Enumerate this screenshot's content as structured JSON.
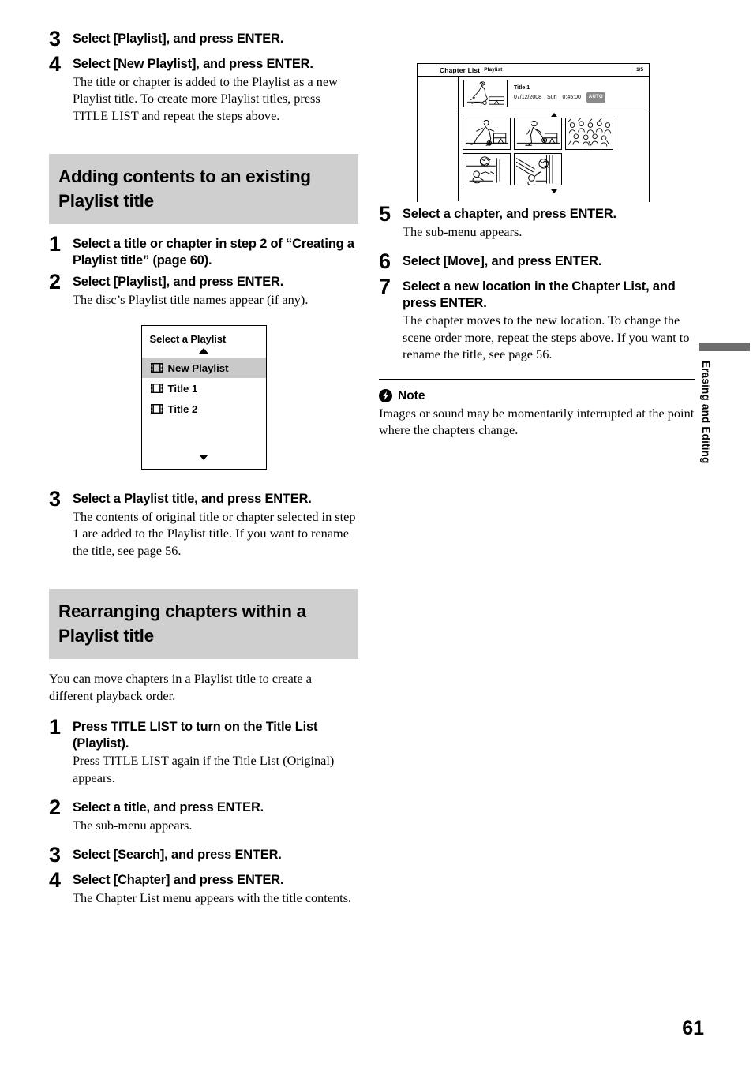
{
  "page": {
    "number": "61",
    "side_tab": "Erasing and Editing"
  },
  "left_column": {
    "steps_top": [
      {
        "num": "3",
        "title": "Select [Playlist], and press ENTER.",
        "desc": ""
      },
      {
        "num": "4",
        "title": "Select [New Playlist], and press ENTER.",
        "desc": "The title or chapter is added to the Playlist as a new Playlist title.\nTo create more Playlist titles, press TITLE LIST and repeat the steps above."
      }
    ],
    "section1": {
      "heading": "Adding contents to an existing Playlist title",
      "steps": [
        {
          "num": "1",
          "title": "Select a title or chapter in step 2 of “Creating a Playlist title” (page 60).",
          "desc": ""
        },
        {
          "num": "2",
          "title": "Select [Playlist], and press ENTER.",
          "desc": "The disc’s Playlist title names appear (if any)."
        }
      ],
      "dialog": {
        "title": "Select a Playlist",
        "items": [
          {
            "label": "New Playlist",
            "selected": true
          },
          {
            "label": "Title 1",
            "selected": false
          },
          {
            "label": "Title 2",
            "selected": false
          }
        ],
        "scroll_up_icon": "triangle-up-icon",
        "scroll_down_icon": "triangle-down-icon",
        "item_icon": "film-strip-icon"
      },
      "step_after_dialog": {
        "num": "3",
        "title": "Select a Playlist title, and press ENTER.",
        "desc": "The contents of original title or chapter selected in step 1 are added to the Playlist title.\nIf you want to rename the title, see page 56."
      }
    },
    "section2": {
      "heading": "Rearranging chapters within a Playlist title",
      "intro": "You can move chapters in a Playlist title to create a different playback order.",
      "steps": [
        {
          "num": "1",
          "title": "Press TITLE LIST to turn on the Title List (Playlist).",
          "desc": "Press TITLE LIST again if the Title List (Original) appears."
        },
        {
          "num": "2",
          "title": "Select a title, and press ENTER.",
          "desc": "The sub-menu appears."
        },
        {
          "num": "3",
          "title": "Select [Search], and press ENTER.",
          "desc": ""
        },
        {
          "num": "4",
          "title": "Select [Chapter] and press ENTER.",
          "desc": "The Chapter List menu appears with the title contents."
        }
      ]
    }
  },
  "right_column": {
    "screen": {
      "header_title": "Chapter List",
      "header_subtitle": "Playlist",
      "page_indicator": "1/5",
      "title_name": "Title 1",
      "title_date": "07/12/2008",
      "title_day": "Sun",
      "title_duration": "0:45:00",
      "title_badge": "AUTO",
      "thumbnail_count": 5,
      "scroll_up_icon": "triangle-up-icon",
      "scroll_down_icon": "triangle-down-icon"
    },
    "steps": [
      {
        "num": "5",
        "title": "Select a chapter, and press ENTER.",
        "desc": "The sub-menu appears."
      },
      {
        "num": "6",
        "title": "Select [Move], and press ENTER.",
        "desc": ""
      },
      {
        "num": "7",
        "title": "Select a new location in the Chapter List, and press ENTER.",
        "desc": "The chapter moves to the new location.\nTo change the scene order more, repeat the steps above.\nIf you want to rename the title, see page 56."
      }
    ],
    "note": {
      "icon": "lightning-bolt-icon",
      "label": "Note",
      "text": "Images or sound may be momentarily interrupted at the point where the chapters change."
    }
  },
  "colors": {
    "heading_bg": "#cfcfcf",
    "selected_row": "#c9c9c9",
    "badge_bg": "#8a8a8a",
    "side_tab_bar": "#6e6e6e"
  }
}
